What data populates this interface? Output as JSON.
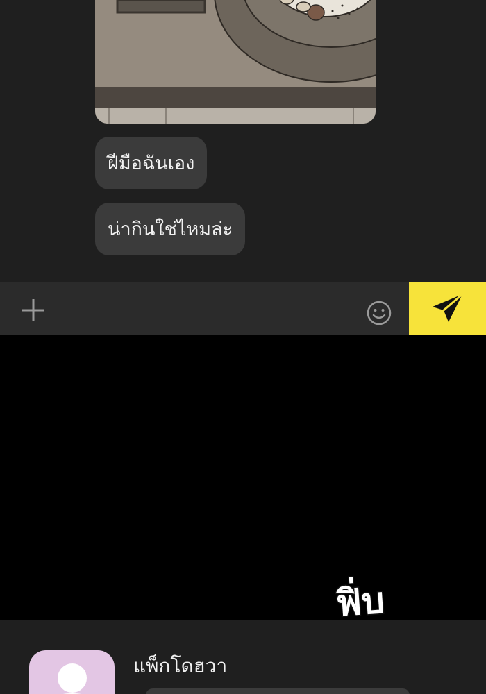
{
  "chat": {
    "messages": [
      {
        "type": "image",
        "content": "food-photo"
      },
      {
        "type": "text",
        "text": "ฝีมือฉันเอง"
      },
      {
        "type": "text",
        "text": "น่ากินใช่ไหมล่ะ"
      }
    ]
  },
  "input_bar": {
    "add_icon": "plus-icon",
    "emoji_icon": "smiley-icon",
    "send_icon": "paper-plane-icon",
    "send_color": "#f7e33a"
  },
  "overlay": {
    "sfx": "ฟิ่บ"
  },
  "next_message": {
    "sender": "แพ็กโดฮวา",
    "avatar_color": "#e3c6e4"
  }
}
